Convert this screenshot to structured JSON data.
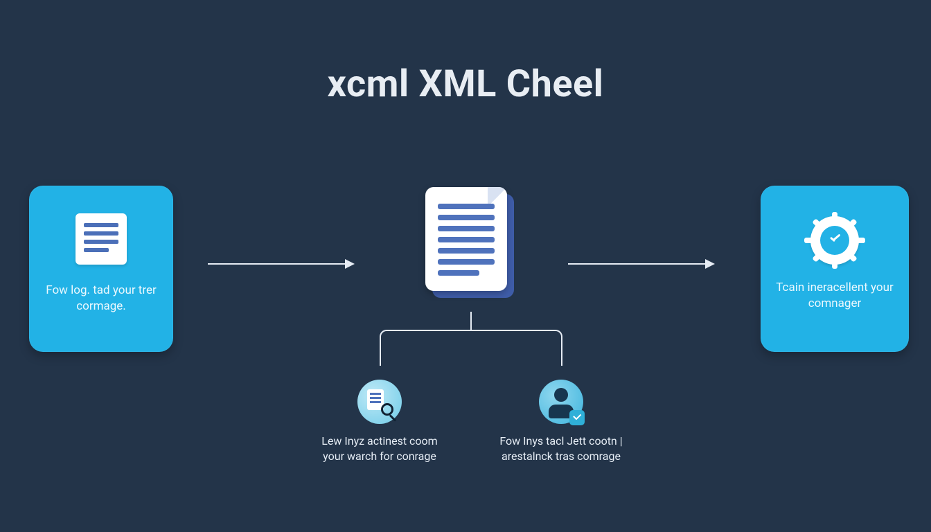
{
  "title": "xcml XML Cheel",
  "cards": {
    "left": {
      "caption": "Fow log. tad your trer cormage."
    },
    "right": {
      "caption": "Tcain ineracellent your comnager"
    }
  },
  "bottom": {
    "left": {
      "caption": "Lew Inyz actinest coom your warch for conrage"
    },
    "right": {
      "caption": "Fow Inys tacl Jett cootn | arestalnck tras comrage"
    }
  }
}
